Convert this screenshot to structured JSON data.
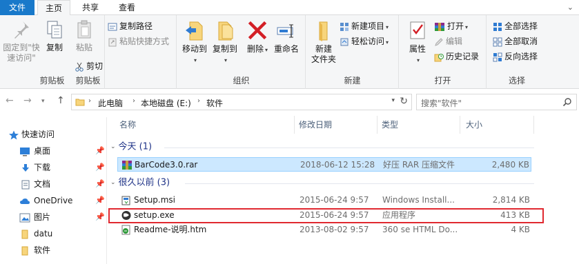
{
  "tabs": {
    "file": "文件",
    "home": "主页",
    "share": "共享",
    "view": "查看"
  },
  "ribbon": {
    "clipboard": {
      "group_label": "剪贴板",
      "pin_label_1": "固定到\"快",
      "pin_label_2": "速访问\"",
      "copy": "复制",
      "paste": "粘贴",
      "copy_path": "复制路径",
      "paste_shortcut": "粘贴快捷方式",
      "cut": "剪切"
    },
    "organize": {
      "group_label": "组织",
      "move_to": "移动到",
      "copy_to": "复制到",
      "delete": "删除",
      "rename": "重命名"
    },
    "new": {
      "group_label": "新建",
      "new_folder_1": "新建",
      "new_folder_2": "文件夹",
      "new_item": "新建项目",
      "easy_access": "轻松访问"
    },
    "open": {
      "group_label": "打开",
      "properties": "属性",
      "open": "打开",
      "edit": "编辑",
      "history": "历史记录"
    },
    "select": {
      "group_label": "选择",
      "select_all": "全部选择",
      "select_none": "全部取消",
      "invert": "反向选择"
    }
  },
  "address": {
    "crumbs": [
      "此电脑",
      "本地磁盘 (E:)",
      "软件"
    ],
    "search_placeholder": "搜索\"软件\""
  },
  "nav": {
    "quick_access": "快速访问",
    "items": [
      "桌面",
      "下载",
      "文档",
      "OneDrive",
      "图片",
      "datu",
      "软件"
    ]
  },
  "columns": {
    "name": "名称",
    "date": "修改日期",
    "type": "类型",
    "size": "大小"
  },
  "groups": {
    "today": "今天 (1)",
    "long_ago": "很久以前 (3)"
  },
  "files": [
    {
      "name": "BarCode3.0.rar",
      "date": "2018-06-12 15:28",
      "type": "好压 RAR 压缩文件",
      "size": "2,480 KB"
    },
    {
      "name": "Setup.msi",
      "date": "2015-06-24 9:57",
      "type": "Windows Install...",
      "size": "2,814 KB"
    },
    {
      "name": "setup.exe",
      "date": "2015-06-24 9:57",
      "type": "应用程序",
      "size": "413 KB"
    },
    {
      "name": "Readme-说明.htm",
      "date": "2013-08-02 9:57",
      "type": "360 se HTML Do...",
      "size": "4 KB"
    }
  ],
  "colors": {
    "accent": "#1979ca",
    "selection": "#cce8ff",
    "highlight_box": "#e0282f"
  }
}
